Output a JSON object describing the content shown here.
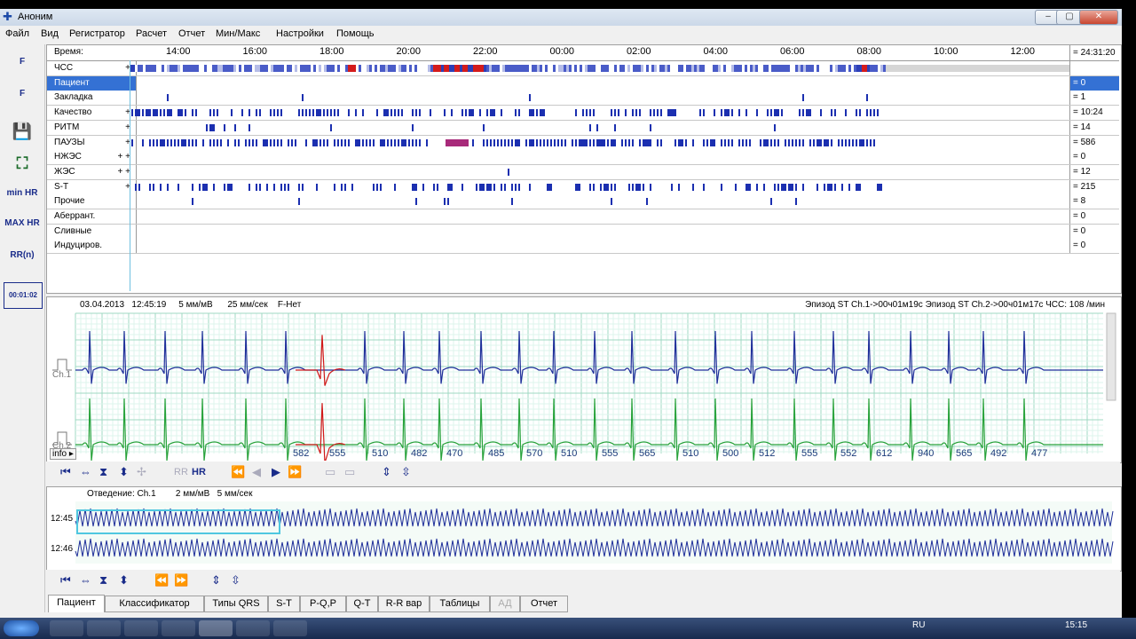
{
  "window": {
    "title": "Аноним",
    "minimize": "‒",
    "maximize": "▢",
    "close": "✕"
  },
  "menu": [
    "Файл",
    "Вид",
    "Регистратор",
    "Расчет",
    "Отчет",
    "Мин/Макс",
    "Настройки",
    "Помощь"
  ],
  "toolbar": [
    {
      "icon": "f-arrow-icon",
      "label": "F"
    },
    {
      "icon": "f-grid-icon",
      "label": "F"
    },
    {
      "icon": "save-icon",
      "label": "💾"
    },
    {
      "icon": "zoom-fit-icon",
      "label": "⛶"
    },
    {
      "icon": "min-hr-icon",
      "label": "min HR"
    },
    {
      "icon": "max-hr-icon",
      "label": "MAX HR"
    },
    {
      "icon": "rr-n-icon",
      "label": "RR(n)"
    },
    {
      "icon": "timer-icon",
      "label": "00:01:02"
    }
  ],
  "timeline": {
    "label": "Время:",
    "ticks": [
      "14:00",
      "16:00",
      "18:00",
      "20:00",
      "22:00",
      "00:00",
      "02:00",
      "04:00",
      "06:00",
      "08:00",
      "10:00",
      "12:00"
    ],
    "total": "= 24:31:20"
  },
  "bands": [
    {
      "label": "ЧСС",
      "plus": "+",
      "value": ""
    },
    {
      "label": "Пациент",
      "plus": "",
      "value": "= 0",
      "selected": true
    },
    {
      "label": "Закладка",
      "plus": "",
      "value": "= 1"
    },
    {
      "label": "Качество",
      "plus": "+",
      "value": "= 10:24"
    },
    {
      "label": "РИТМ",
      "plus": "+",
      "value": "= 14"
    },
    {
      "label": "ПАУЗЫ",
      "plus": "+",
      "value": "= 586"
    },
    {
      "label": "НЖЭС",
      "plus": "+ +",
      "value": "= 0"
    },
    {
      "label": "ЖЭС",
      "plus": "+ +",
      "value": "= 12"
    },
    {
      "label": "S-T",
      "plus": "+",
      "value": "= 215"
    },
    {
      "label": "Прочие",
      "plus": "",
      "value": "= 8"
    },
    {
      "label": "Аберрант.",
      "plus": "",
      "value": "= 0"
    },
    {
      "label": "Сливные",
      "plus": "",
      "value": "= 0"
    },
    {
      "label": "Индуциров.",
      "plus": "",
      "value": "= 0"
    }
  ],
  "ecg": {
    "date": "03.04.2013",
    "time": "12:45:19",
    "gain": "5 мм/мВ",
    "speed": "25 мм/сек",
    "filter": "F-Нет",
    "episode": "Эпизод ST Ch.1->00ч01м19с Эпизод ST Ch.2->00ч01м17с ЧСС: 108 /мин",
    "ch1": "Ch.1",
    "ch2": "Ch.2",
    "info_button": "info ▸",
    "rr": [
      "582",
      "555",
      "510",
      "482",
      "470",
      "485",
      "570",
      "510",
      "555",
      "565",
      "510",
      "500",
      "512",
      "555",
      "552",
      "612",
      "940",
      "565",
      "492",
      "477"
    ],
    "colors": {
      "ch1": "#1f2f9a",
      "ch2": "#27a23a",
      "ectopic": "#d01818",
      "grid": "#b9e6d6"
    }
  },
  "controls1": {
    "rr": "RR",
    "hr": "HR"
  },
  "trend": {
    "lead": "Отведение: Ch.1",
    "gain": "2 мм/мВ",
    "speed": "5 мм/сек",
    "row1": "12:45",
    "row2": "12:46"
  },
  "tabs": [
    "Пациент",
    "Классификатор",
    "Типы QRS",
    "S-T",
    "P-Q,P",
    "Q-T",
    "R-R вар",
    "Таблицы",
    "АД",
    "Отчет"
  ],
  "taskbar": {
    "lang": "RU",
    "time": "15:15"
  }
}
